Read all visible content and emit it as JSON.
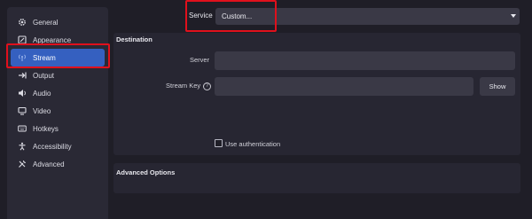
{
  "sidebar": {
    "items": [
      {
        "label": "General",
        "icon": "gear-icon"
      },
      {
        "label": "Appearance",
        "icon": "appearance-icon"
      },
      {
        "label": "Stream",
        "icon": "antenna-icon",
        "active": true
      },
      {
        "label": "Output",
        "icon": "output-icon"
      },
      {
        "label": "Audio",
        "icon": "speaker-icon"
      },
      {
        "label": "Video",
        "icon": "monitor-icon"
      },
      {
        "label": "Hotkeys",
        "icon": "keyboard-icon"
      },
      {
        "label": "Accessibility",
        "icon": "accessibility-icon"
      },
      {
        "label": "Advanced",
        "icon": "tools-icon"
      }
    ]
  },
  "service": {
    "label": "Service",
    "value": "Custom..."
  },
  "destination": {
    "title": "Destination",
    "server_label": "Server",
    "server_value": "",
    "stream_key_label": "Stream Key",
    "stream_key_value": "",
    "show_button": "Show",
    "use_auth_label": "Use authentication",
    "use_auth_checked": false
  },
  "advanced": {
    "title": "Advanced Options"
  },
  "colors": {
    "highlight": "#e0101c",
    "active_item": "#3560c0"
  }
}
